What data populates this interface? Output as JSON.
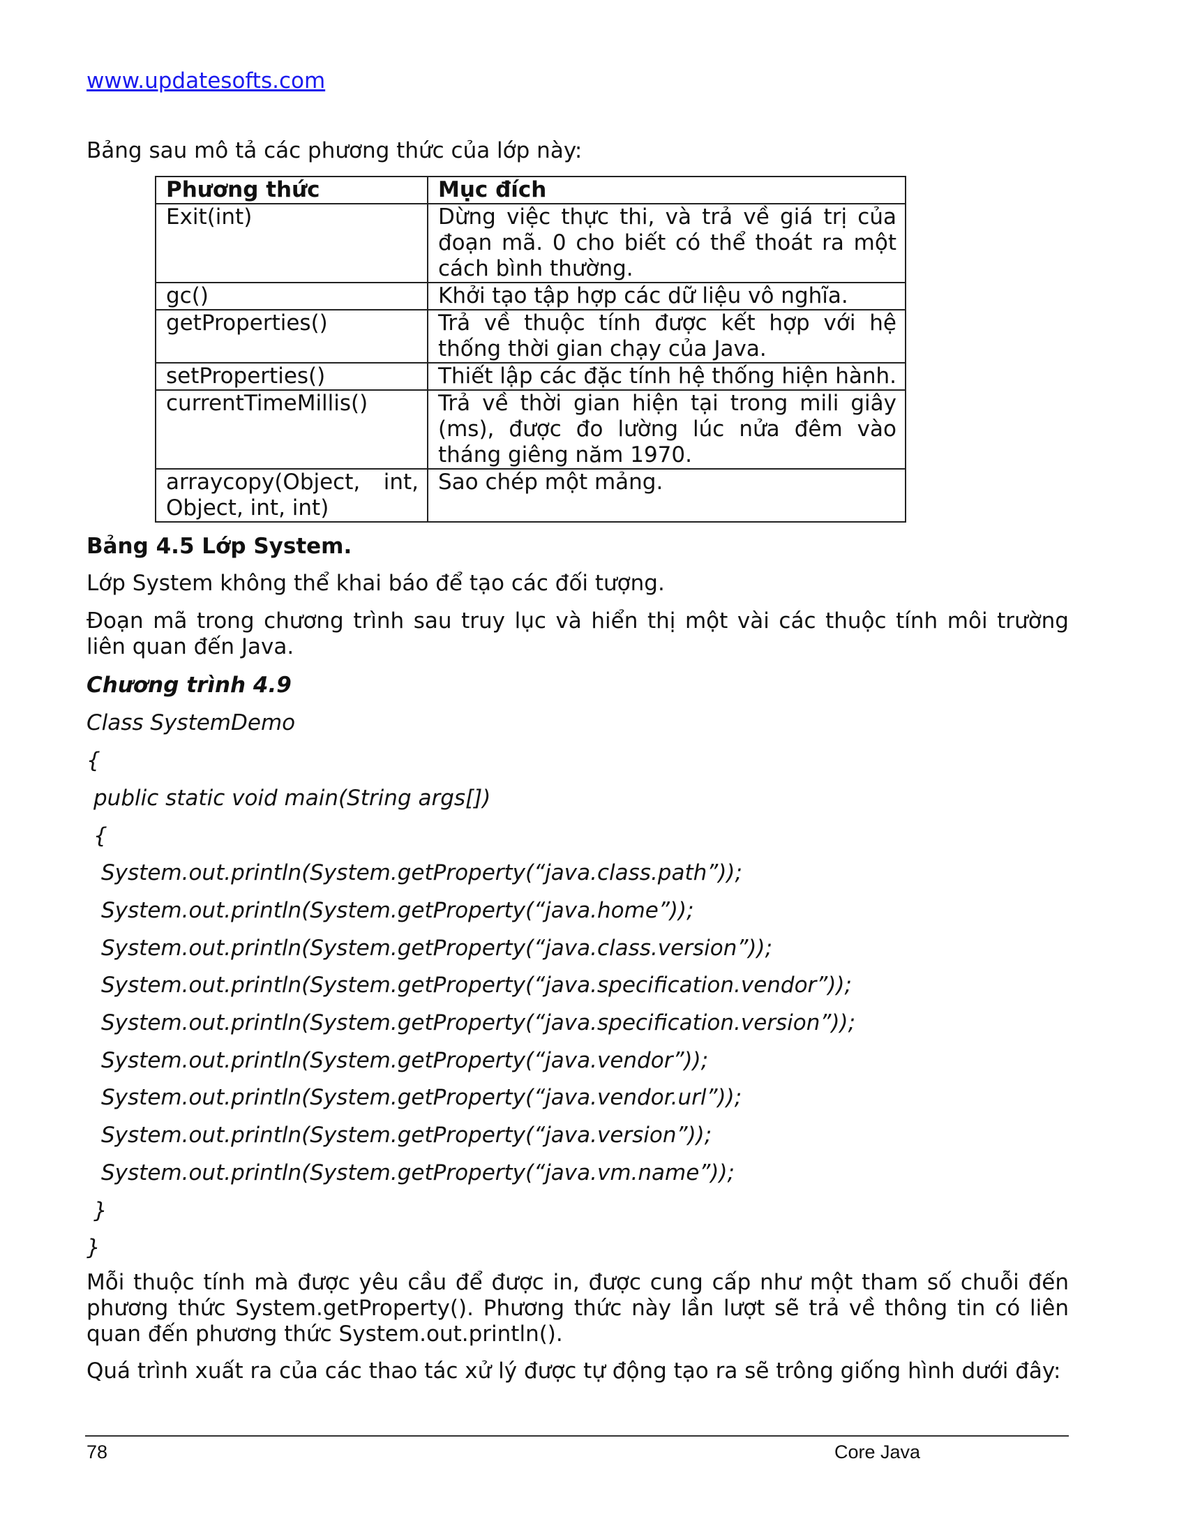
{
  "header": {
    "link": "www.updatesofts.com"
  },
  "intro": "Bảng sau mô tả các phương thức của lớp này:",
  "table": {
    "headers": [
      "Phương thức",
      "Mục đích"
    ],
    "rows": [
      {
        "method": "Exit(int)",
        "purpose": "Dừng việc thực thi, và trả về giá trị của đoạn mã. 0 cho biết có thể thoát ra một cách bình thường."
      },
      {
        "method": "gc()",
        "purpose": "Khởi tạo tập hợp các dữ liệu vô nghĩa."
      },
      {
        "method": "getProperties()",
        "purpose": "Trả về thuộc tính được kết hợp với hệ thống thời gian chạy của Java."
      },
      {
        "method": "setProperties()",
        "purpose": "Thiết lập các đặc tính hệ thống hiện hành."
      },
      {
        "method": "currentTimeMillis()",
        "purpose": "Trả về thời gian hiện tại trong mili giây (ms), được đo lường lúc nửa đêm vào tháng giêng năm 1970."
      },
      {
        "method": "arraycopy(Object, int, Object, int, int)",
        "purpose": "Sao chép một mảng."
      }
    ]
  },
  "caption": "Bảng 4.5 Lớp System.",
  "paragraphs": {
    "p1": "Lớp System không thể khai báo để tạo các đối tượng.",
    "p2": "Đoạn mã trong chương trình sau truy lục và hiển thị một vài các thuộc tính môi trường liên quan đến Java.",
    "p3": "Mỗi thuộc tính mà được yêu cầu để được in, được cung cấp như một tham số chuỗi đến phương thức System.getProperty(). Phương thức này lần lượt sẽ trả về thông tin có liên quan đến phương thức System.out.println().",
    "p4": "Quá trình xuất ra của các thao tác xử lý được tự động tạo ra sẽ trông giống hình dưới đây:"
  },
  "program": {
    "title": "Chương trình 4.9",
    "code": [
      "Class SystemDemo",
      "{",
      "public static void main(String args[])",
      "{",
      "System.out.println(System.getProperty(“java.class.path”));",
      "System.out.println(System.getProperty(“java.home”));",
      "System.out.println(System.getProperty(“java.class.version”));",
      "System.out.println(System.getProperty(“java.specification.vendor”));",
      "System.out.println(System.getProperty(“java.specification.version”));",
      "System.out.println(System.getProperty(“java.vendor”));",
      "System.out.println(System.getProperty(“java.vendor.url”));",
      "System.out.println(System.getProperty(“java.version”));",
      "System.out.println(System.getProperty(“java.vm.name”));",
      "}",
      "}"
    ]
  },
  "footer": {
    "page_number": "78",
    "book_title": "Core Java"
  }
}
